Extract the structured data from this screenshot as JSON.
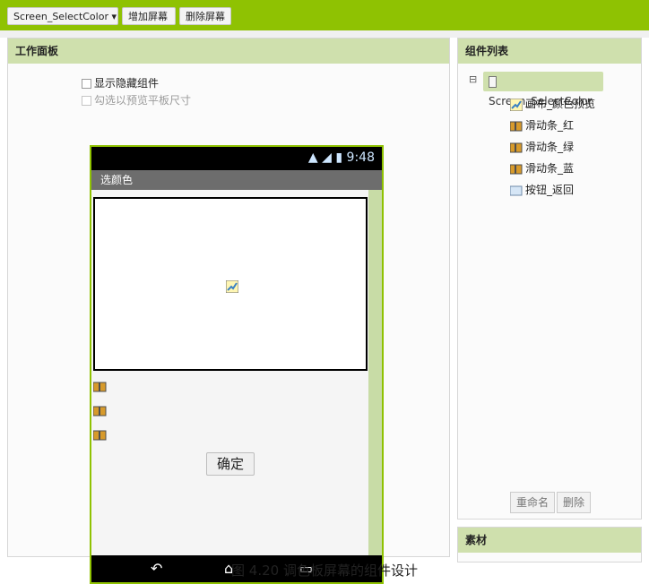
{
  "toolbar": {
    "screen_selector": "Screen_SelectColor ▾",
    "add_screen_label": "增加屏幕",
    "remove_screen_label": "删除屏幕"
  },
  "work_panel": {
    "title": "工作面板",
    "show_hidden_label": "显示隐藏组件",
    "preview_tablet_label": "勾选以预览平板尺寸"
  },
  "phone": {
    "status_time": "9:48",
    "screen_title": "选颜色",
    "confirm_label": "确定"
  },
  "component_list": {
    "title": "组件列表",
    "root_label": "Screen_SelectColor",
    "children": [
      {
        "label": "画布_颜色预览",
        "icon": "canvas-icon"
      },
      {
        "label": "滑动条_红",
        "icon": "slider-icon"
      },
      {
        "label": "滑动条_绿",
        "icon": "slider-icon"
      },
      {
        "label": "滑动条_蓝",
        "icon": "slider-icon"
      },
      {
        "label": "按钮_返回",
        "icon": "button-icon"
      }
    ],
    "rename_label": "重命名",
    "delete_label": "删除"
  },
  "assets": {
    "title": "素材"
  },
  "caption": "图 4.20 调色板屏幕的组件设计",
  "colors": {
    "toolbar_bg": "#8fc202",
    "panel_header": "#cfe0ad",
    "phone_border": "#8fc202"
  }
}
